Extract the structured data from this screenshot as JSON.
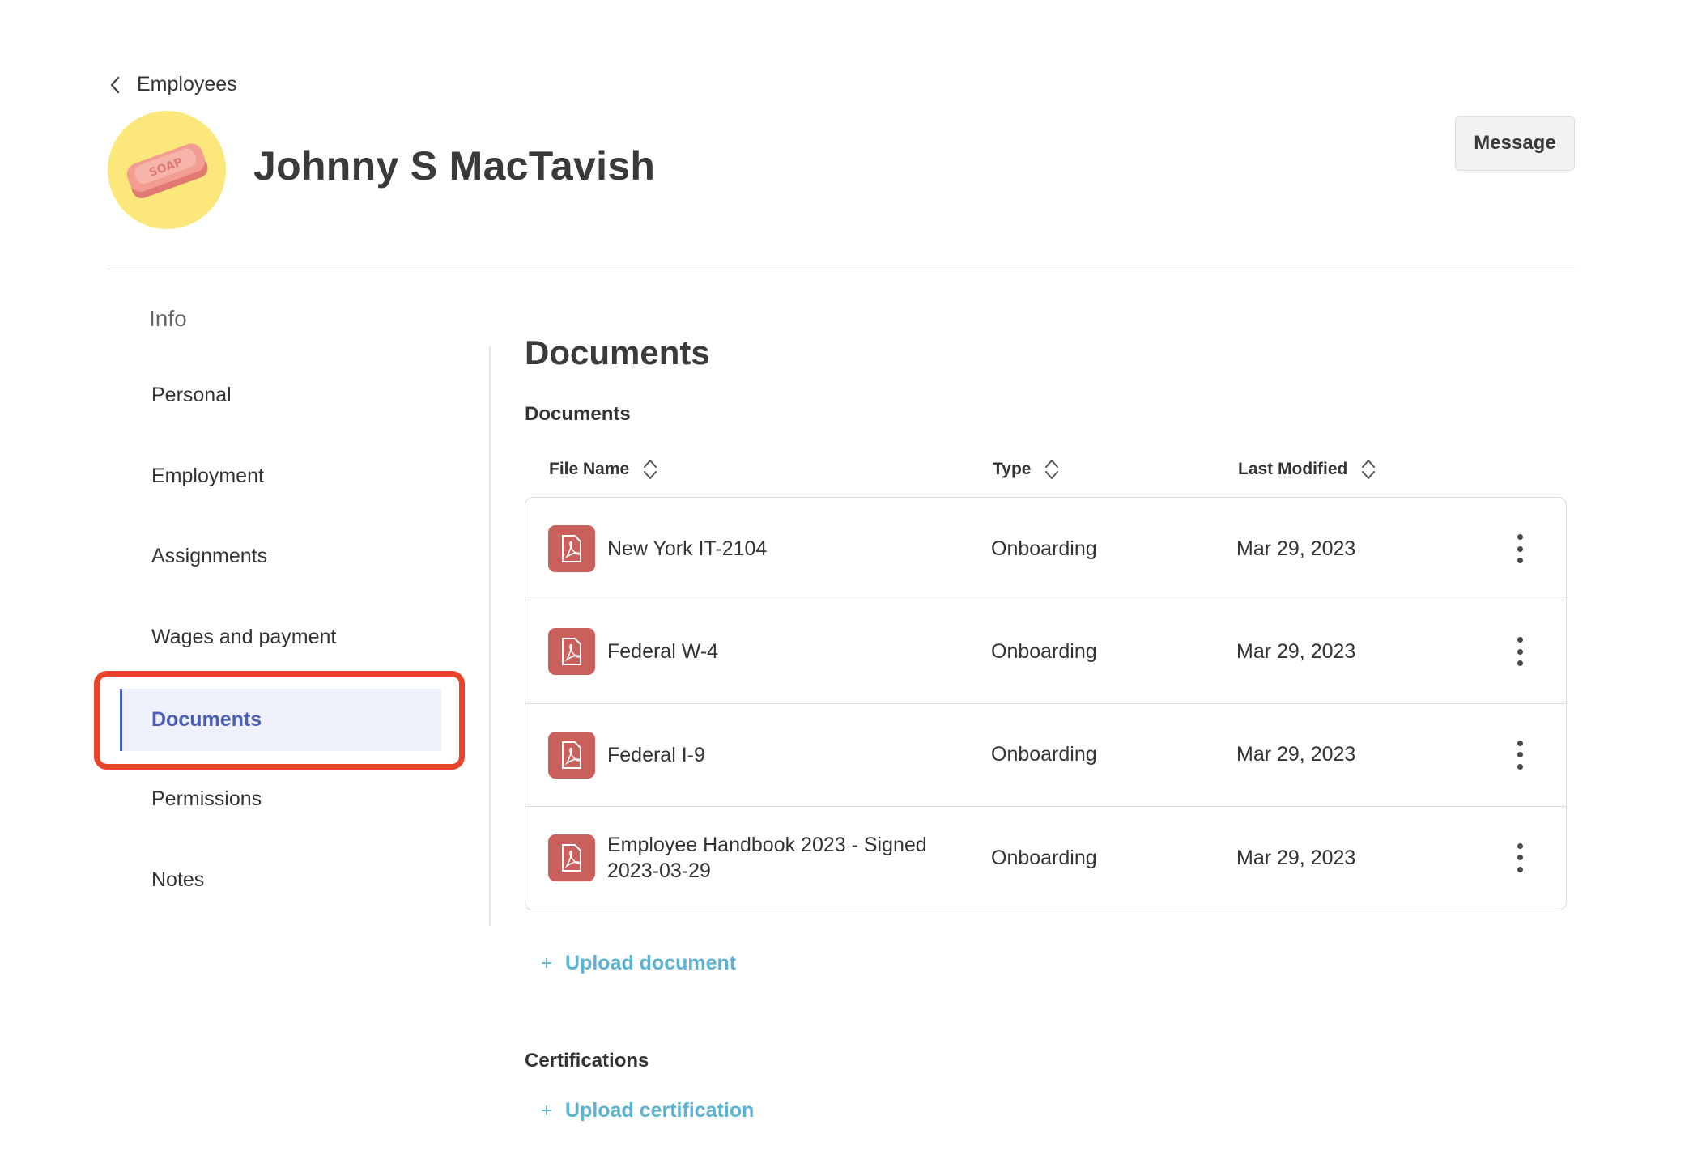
{
  "header": {
    "back_label": "Employees",
    "employee_name": "Johnny S MacTavish",
    "message_button": "Message",
    "avatar_text": "SOAP"
  },
  "sidebar": {
    "heading": "Info",
    "items": [
      {
        "label": "Personal"
      },
      {
        "label": "Employment"
      },
      {
        "label": "Assignments"
      },
      {
        "label": "Wages and payment"
      },
      {
        "label": "Documents",
        "active": true
      },
      {
        "label": "Permissions"
      },
      {
        "label": "Notes"
      }
    ]
  },
  "main": {
    "title": "Documents",
    "documents_section": {
      "title": "Documents",
      "columns": [
        "File Name",
        "Type",
        "Last Modified"
      ],
      "rows": [
        {
          "file_name": "New York IT-2104",
          "type": "Onboarding",
          "last_modified": "Mar 29, 2023"
        },
        {
          "file_name": "Federal W-4",
          "type": "Onboarding",
          "last_modified": "Mar 29, 2023"
        },
        {
          "file_name": "Federal I-9",
          "type": "Onboarding",
          "last_modified": "Mar 29, 2023"
        },
        {
          "file_name": "Employee Handbook 2023 - Signed 2023-03-29",
          "type": "Onboarding",
          "last_modified": "Mar 29, 2023"
        }
      ],
      "upload_label": "Upload document"
    },
    "certifications_section": {
      "title": "Certifications",
      "upload_label": "Upload certification"
    },
    "plus_glyph": "+"
  },
  "colors": {
    "accent": "#4c5fb8",
    "link": "#5cb2d2",
    "pdf_icon": "#c9605c",
    "highlight": "#e8442b",
    "avatar_bg": "#fbe77a"
  },
  "icons": {
    "back": "chevron-left-icon",
    "sort": "sort-icon",
    "file": "pdf-icon",
    "more": "kebab-menu-icon"
  }
}
